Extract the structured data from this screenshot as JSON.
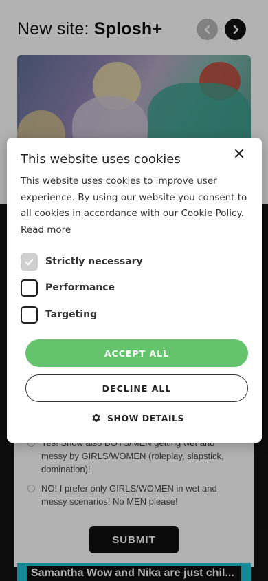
{
  "header": {
    "title_prefix": "New site: ",
    "title_brand": "Splosh+"
  },
  "poll": {
    "option1": "Yes! Show also BOYS/MEN getting wet and messy by GIRLS/WOMEN (roleplay, slapstick, domination)!",
    "option2": "NO! I prefer only GIRLS/WOMEN in wet and messy scenarios! No MEN please!",
    "submit_label": "SUBMIT"
  },
  "banner": {
    "text": "Samantha Wow and Nika are just chil..."
  },
  "cookie_modal": {
    "title": "This website uses cookies",
    "body": "This website uses cookies to improve user experience. By using our website you consent to all cookies in accordance with our Cookie Policy.",
    "read_more": "Read more",
    "options": [
      {
        "label": "Strictly necessary",
        "checked": true,
        "disabled": true
      },
      {
        "label": "Performance",
        "checked": false
      },
      {
        "label": "Targeting",
        "checked": false
      }
    ],
    "accept_label": "ACCEPT ALL",
    "decline_label": "DECLINE ALL",
    "details_label": "SHOW DETAILS"
  },
  "colors": {
    "accept": "#64c36c",
    "banner": "#1ec3d6"
  }
}
